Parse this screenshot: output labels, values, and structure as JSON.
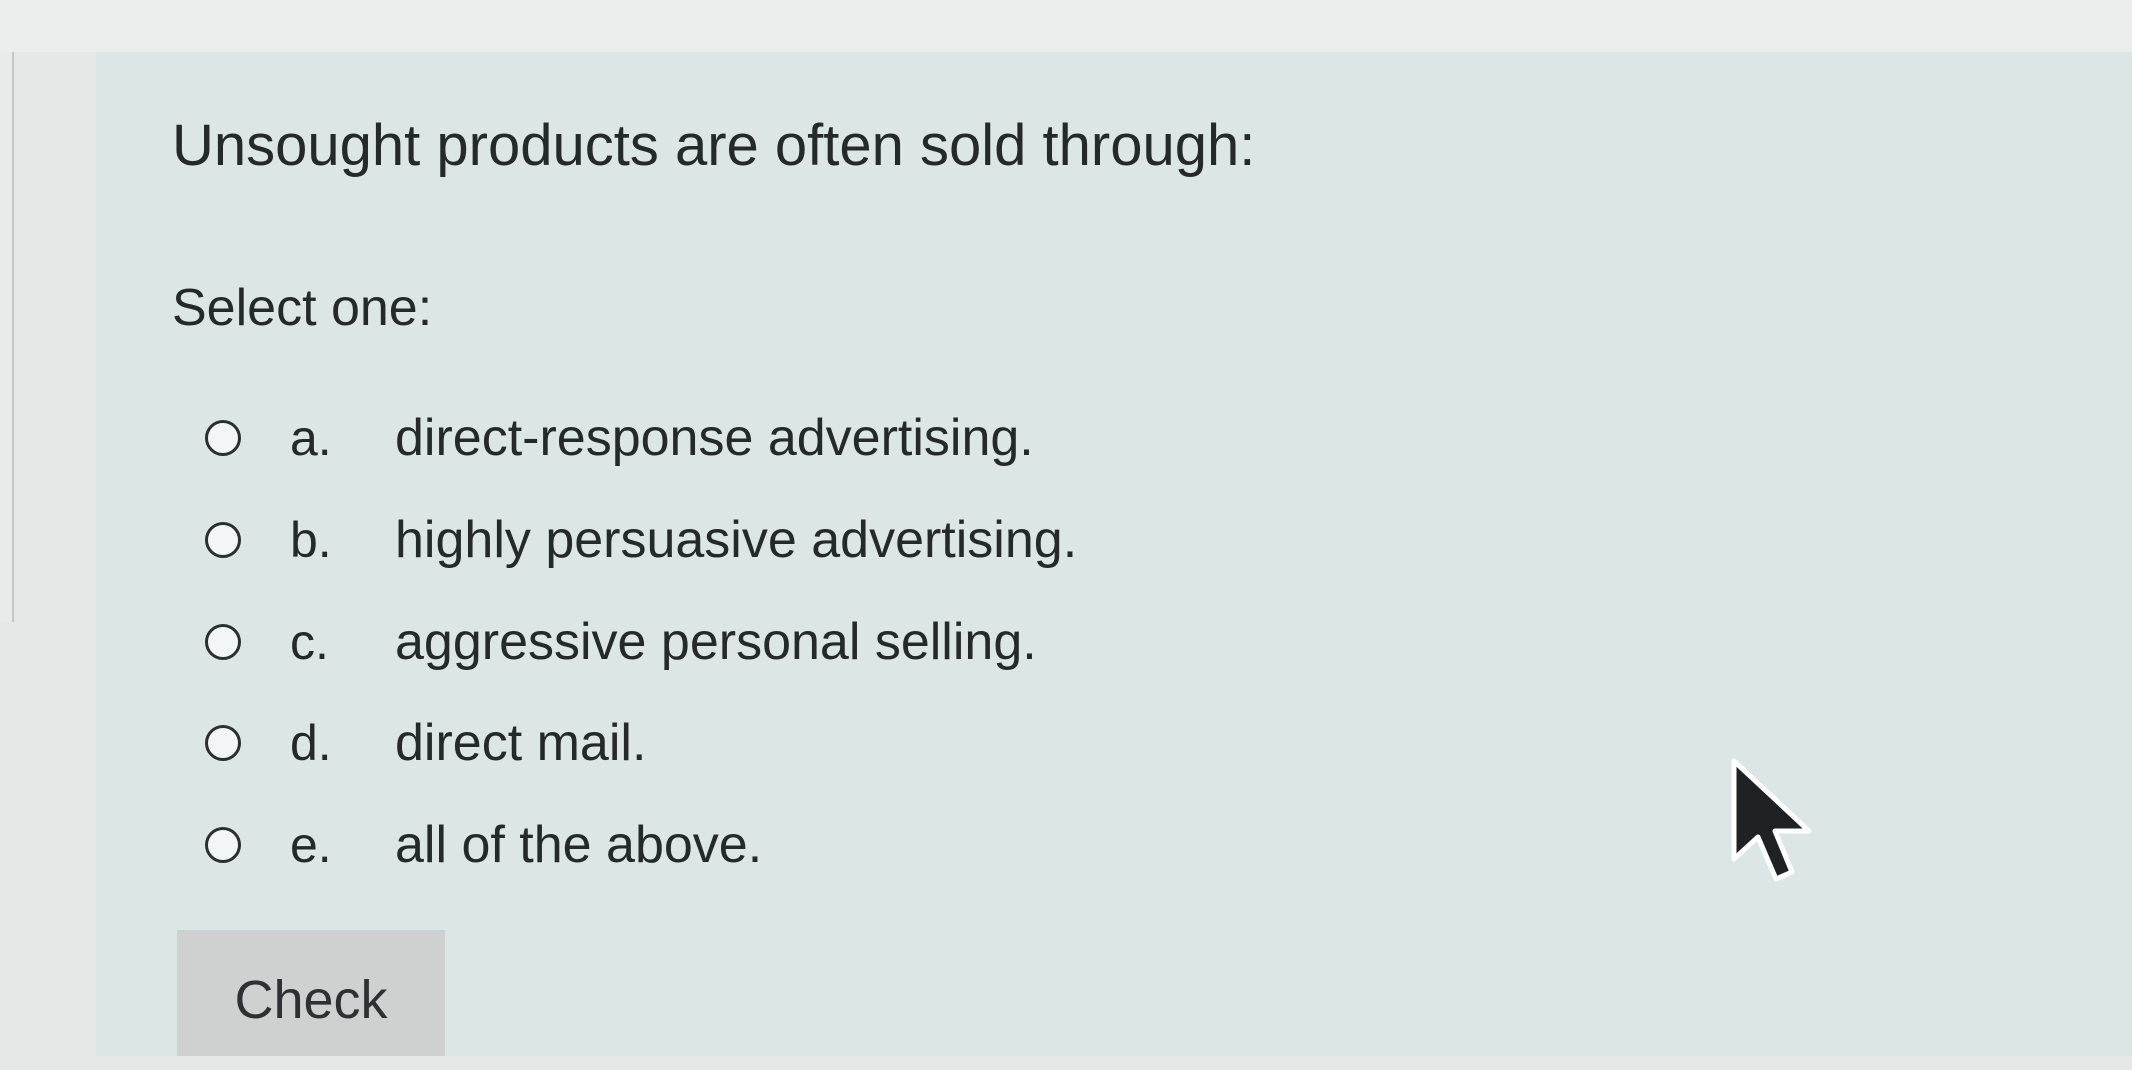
{
  "question": {
    "text": "Unsought products are often sold through:",
    "prompt": "Select one:"
  },
  "options": [
    {
      "letter": "a.",
      "text": "direct-response advertising.",
      "selected": false
    },
    {
      "letter": "b.",
      "text": "highly persuasive advertising.",
      "selected": false
    },
    {
      "letter": "c.",
      "text": "aggressive personal selling.",
      "selected": false
    },
    {
      "letter": "d.",
      "text": "direct mail.",
      "selected": false
    },
    {
      "letter": "e.",
      "text": "all of the above.",
      "selected": false
    }
  ],
  "actions": {
    "check_label": "Check"
  },
  "cursor": {
    "icon": "arrow-cursor-icon"
  },
  "colors": {
    "panel_background": "#dde6e7",
    "button_background": "#cfd1d1",
    "text": "#26292b"
  }
}
